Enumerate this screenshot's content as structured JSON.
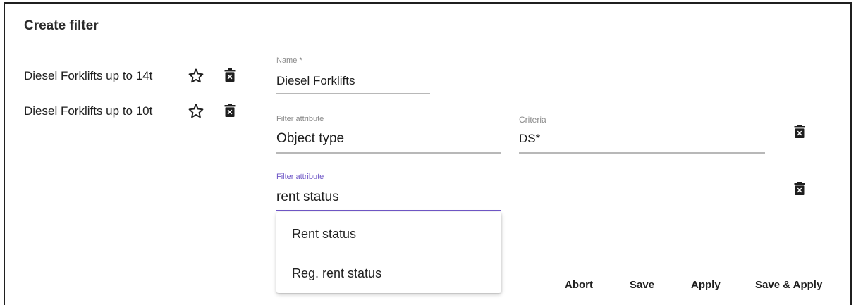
{
  "dialog": {
    "title": "Create filter"
  },
  "saved_filters": [
    {
      "label": "Diesel Forklifts up to 14t"
    },
    {
      "label": "Diesel Forklifts up to 10t"
    }
  ],
  "name_field": {
    "label": "Name *",
    "value": "Diesel Forklifts"
  },
  "filter_rows": [
    {
      "attribute_label": "Filter attribute",
      "attribute_value": "Object type",
      "criteria_label": "Criteria",
      "criteria_value": "DS*"
    },
    {
      "attribute_label": "Filter attribute",
      "attribute_value": "rent status"
    }
  ],
  "dropdown": {
    "options": [
      "Rent status",
      "Reg. rent status"
    ]
  },
  "actions": {
    "abort": "Abort",
    "save": "Save",
    "apply": "Apply",
    "save_apply": "Save & Apply"
  },
  "colors": {
    "accent": "#6f57c7",
    "text": "#1e1e1e",
    "muted": "#8a8a8a",
    "divider": "#b8b8b8"
  },
  "icons": {
    "favorite": "star-outline-icon",
    "delete": "trash-icon"
  }
}
